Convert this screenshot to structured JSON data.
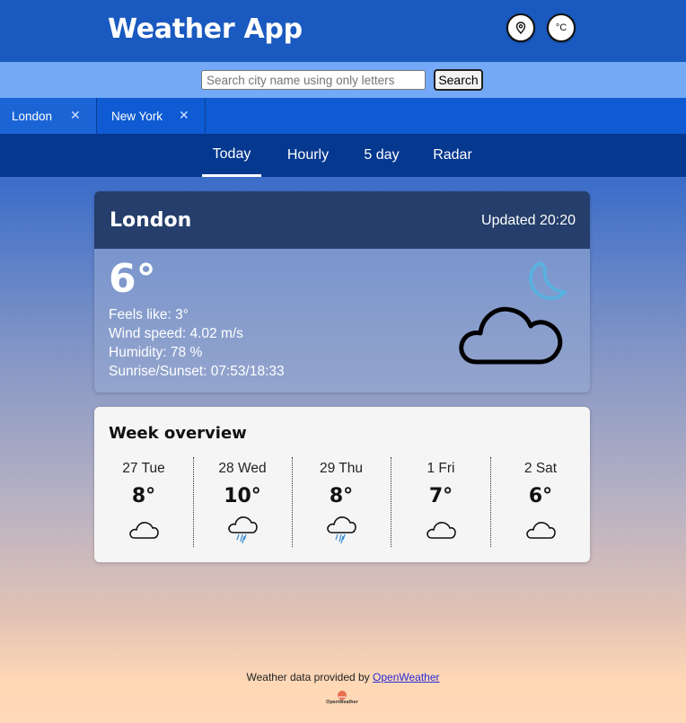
{
  "header": {
    "title": "Weather App",
    "unit_button": "°C"
  },
  "search": {
    "placeholder": "Search city name using only letters",
    "value": "",
    "button_label": "Search"
  },
  "city_tabs": [
    {
      "label": "London",
      "close": "✕"
    },
    {
      "label": "New York",
      "close": "✕"
    }
  ],
  "nav_tabs": [
    {
      "label": "Today",
      "active": true
    },
    {
      "label": "Hourly",
      "active": false
    },
    {
      "label": "5 day",
      "active": false
    },
    {
      "label": "Radar",
      "active": false
    }
  ],
  "current": {
    "city": "London",
    "updated": "Updated 20:20",
    "temp": "6°",
    "feels_like": "Feels like: 3°",
    "wind": "Wind speed: 4.02 m/s",
    "humidity": "Humidity: 78 %",
    "sun": "Sunrise/Sunset: 07:53/18:33",
    "icon": "cloudy-night-icon"
  },
  "week": {
    "title": "Week overview",
    "days": [
      {
        "label": "27 Tue",
        "temp": "8°",
        "icon": "cloud-icon"
      },
      {
        "label": "28 Wed",
        "temp": "10°",
        "icon": "rain-cloud-icon"
      },
      {
        "label": "29 Thu",
        "temp": "8°",
        "icon": "rain-cloud-icon"
      },
      {
        "label": "1 Fri",
        "temp": "7°",
        "icon": "cloud-icon"
      },
      {
        "label": "2 Sat",
        "temp": "6°",
        "icon": "cloud-icon"
      }
    ]
  },
  "footer": {
    "text": "Weather data provided by ",
    "link": "OpenWeather",
    "logo_text": "OpenWeather"
  },
  "colors": {
    "header": "#1a5ac0",
    "nav": "#05388f",
    "card_header": "#253e6b"
  }
}
